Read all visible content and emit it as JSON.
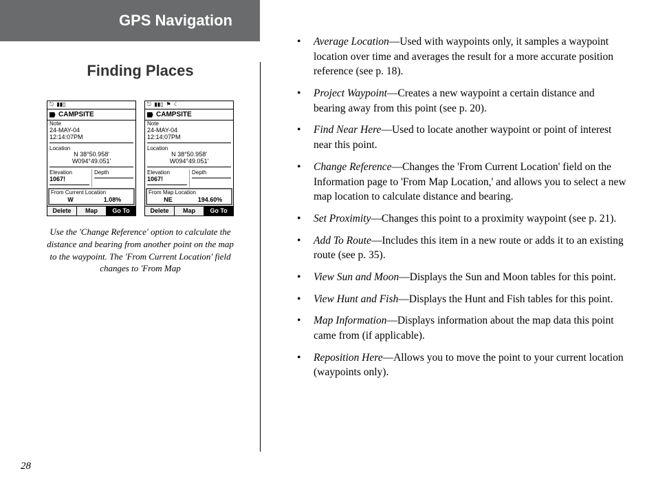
{
  "header": {
    "title": "GPS Navigation"
  },
  "left": {
    "subheading": "Finding Places",
    "caption": "Use the 'Change Reference' option to calculate the distance and bearing from another point on the map to the waypoint. The 'From Current Location' field changes to 'From Map",
    "page_number": "28",
    "screens": [
      {
        "name": "CAMPSITE",
        "note_label": "Note",
        "date": "24-MAY-04",
        "time": "12:14:07PM",
        "location_label": "Location",
        "lat": "N  38°50.958'",
        "lon": "W094°49.051'",
        "elev_label": "Elevation",
        "elev": "1067!",
        "depth_label": "Depth",
        "depth": "",
        "from_label": "From Current Location",
        "bearing": "W",
        "dist": "1.08%",
        "buttons": [
          "Delete",
          "Map",
          "Go To"
        ],
        "selected": 2
      },
      {
        "name": "CAMPSITE",
        "note_label": "Note",
        "date": "24-MAY-04",
        "time": "12:14:07PM",
        "location_label": "Location",
        "lat": "N  38°50.958'",
        "lon": "W094°49.051'",
        "elev_label": "Elevation",
        "elev": "1067!",
        "depth_label": "Depth",
        "depth": "",
        "from_label": "From Map Location",
        "bearing": "NE",
        "dist": "194.60%",
        "buttons": [
          "Delete",
          "Map",
          "Go To"
        ],
        "selected": 2
      }
    ]
  },
  "right": {
    "items": [
      {
        "term": "Average Location",
        "desc": "—Used with waypoints only, it samples a waypoint location over time and averages the result for a more accurate position reference (see p. 18)."
      },
      {
        "term": "Project Waypoint",
        "desc": "—Creates a new waypoint a certain distance and bearing away from this point (see p. 20)."
      },
      {
        "term": "Find Near Here",
        "desc": "—Used to locate another waypoint or point of interest near this point."
      },
      {
        "term": "Change Reference",
        "desc": "—Changes the 'From Current Location' field on the Information page to 'From Map Location,' and allows you to select a new map location to calculate distance and bearing."
      },
      {
        "term": "Set Proximity",
        "desc": "—Changes this point to a proximity waypoint (see p. 21)."
      },
      {
        "term": "Add To Route",
        "desc": "—Includes this item in a new route or adds it to an existing route (see p. 35)."
      },
      {
        "term": "View Sun and Moon",
        "desc": "—Displays the Sun and Moon tables for this point."
      },
      {
        "term": "View Hunt and Fish",
        "desc": "—Displays the Hunt and Fish tables for this point."
      },
      {
        "term": "Map Information",
        "desc": "—Displays information about the map data this point came from (if applicable)."
      },
      {
        "term": "Reposition Here",
        "desc": "—Allows you to move the point to your current location (waypoints only)."
      }
    ]
  }
}
